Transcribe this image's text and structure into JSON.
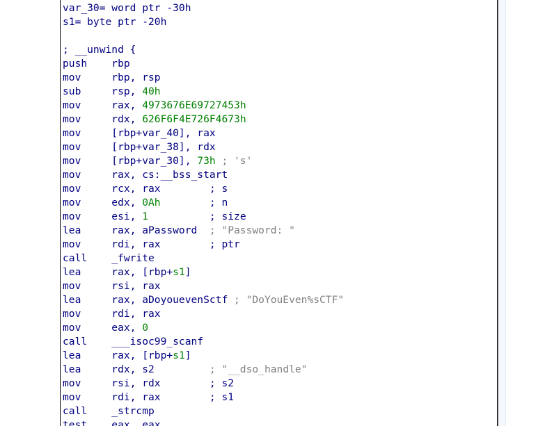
{
  "colors": {
    "code_text": "#000080",
    "number": "#008000",
    "string": "#008000",
    "comment": "#808080",
    "node_border": "#000000",
    "background": "#ffffff"
  },
  "lines": [
    [
      {
        "t": "var_30= word ptr -30h",
        "c": "txt"
      }
    ],
    [
      {
        "t": "s1= byte ptr -20h",
        "c": "txt"
      }
    ],
    [
      {
        "t": "",
        "c": "txt"
      }
    ],
    [
      {
        "t": "; __unwind {",
        "c": "txt"
      }
    ],
    [
      {
        "t": "push    rbp",
        "c": "txt"
      }
    ],
    [
      {
        "t": "mov     rbp, rsp",
        "c": "txt"
      }
    ],
    [
      {
        "t": "sub     rsp, ",
        "c": "txt"
      },
      {
        "t": "40h",
        "c": "num"
      }
    ],
    [
      {
        "t": "mov     rax, ",
        "c": "txt"
      },
      {
        "t": "4973676E69727453h",
        "c": "num"
      }
    ],
    [
      {
        "t": "mov     rdx, ",
        "c": "txt"
      },
      {
        "t": "626F6F4E726F4673h",
        "c": "num"
      }
    ],
    [
      {
        "t": "mov     [rbp+var_40], rax",
        "c": "txt"
      }
    ],
    [
      {
        "t": "mov     [rbp+var_38], rdx",
        "c": "txt"
      }
    ],
    [
      {
        "t": "mov     [rbp+var_30], ",
        "c": "txt"
      },
      {
        "t": "73h",
        "c": "num"
      },
      {
        "t": " ; 's'",
        "c": "cmt"
      }
    ],
    [
      {
        "t": "mov     rax, cs:__bss_start",
        "c": "txt"
      }
    ],
    [
      {
        "t": "mov     rcx, rax        ; s",
        "c": "txt"
      }
    ],
    [
      {
        "t": "mov     edx, ",
        "c": "txt"
      },
      {
        "t": "0Ah",
        "c": "num"
      },
      {
        "t": "        ; n",
        "c": "txt"
      }
    ],
    [
      {
        "t": "mov     esi, ",
        "c": "txt"
      },
      {
        "t": "1",
        "c": "num"
      },
      {
        "t": "          ; size",
        "c": "txt"
      }
    ],
    [
      {
        "t": "lea     rax, aPassword  ",
        "c": "txt"
      },
      {
        "t": "; \"Password: \"",
        "c": "cmt"
      }
    ],
    [
      {
        "t": "mov     rdi, rax        ; ptr",
        "c": "txt"
      }
    ],
    [
      {
        "t": "call    _fwrite",
        "c": "txt"
      }
    ],
    [
      {
        "t": "lea     rax, [rbp+",
        "c": "txt"
      },
      {
        "t": "s1",
        "c": "num"
      },
      {
        "t": "]",
        "c": "txt"
      }
    ],
    [
      {
        "t": "mov     rsi, rax",
        "c": "txt"
      }
    ],
    [
      {
        "t": "lea     rax, aDoyouevenSctf ",
        "c": "txt"
      },
      {
        "t": "; \"DoYouEven%sCTF\"",
        "c": "cmt"
      }
    ],
    [
      {
        "t": "mov     rdi, rax",
        "c": "txt"
      }
    ],
    [
      {
        "t": "mov     eax, ",
        "c": "txt"
      },
      {
        "t": "0",
        "c": "num"
      }
    ],
    [
      {
        "t": "call    ___isoc99_scanf",
        "c": "txt"
      }
    ],
    [
      {
        "t": "lea     rax, [rbp+",
        "c": "txt"
      },
      {
        "t": "s1",
        "c": "num"
      },
      {
        "t": "]",
        "c": "txt"
      }
    ],
    [
      {
        "t": "lea     rdx, s2         ",
        "c": "txt"
      },
      {
        "t": "; \"__dso_handle\"",
        "c": "cmt"
      }
    ],
    [
      {
        "t": "mov     rsi, rdx        ; s2",
        "c": "txt"
      }
    ],
    [
      {
        "t": "mov     rdi, rax        ; s1",
        "c": "txt"
      }
    ],
    [
      {
        "t": "call    _strcmp",
        "c": "txt"
      }
    ],
    [
      {
        "t": "test    eax, eax",
        "c": "txt"
      }
    ]
  ]
}
